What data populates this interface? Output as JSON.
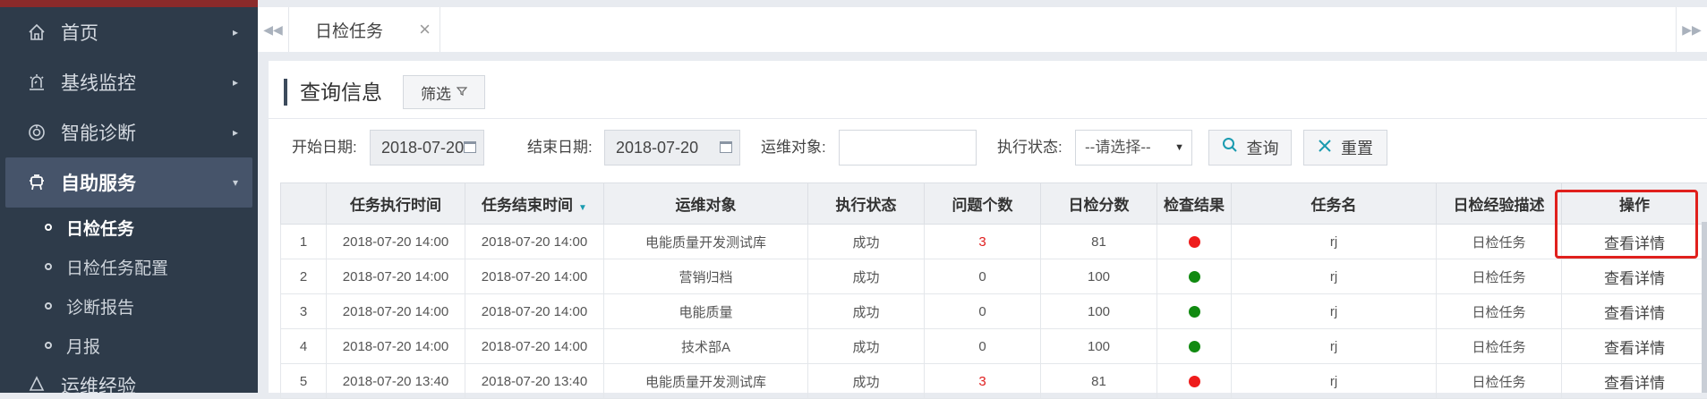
{
  "sidebar": {
    "items": [
      {
        "label": "首页",
        "icon": "home-icon"
      },
      {
        "label": "基线监控",
        "icon": "monitor-alarm-icon"
      },
      {
        "label": "智能诊断",
        "icon": "diagnosis-icon"
      },
      {
        "label": "自助服务",
        "icon": "service-icon",
        "active": true
      }
    ],
    "subitems": [
      {
        "label": "日检任务",
        "active": true
      },
      {
        "label": "日检任务配置"
      },
      {
        "label": "诊断报告"
      },
      {
        "label": "月报"
      }
    ],
    "next_item_partial": "运维经验"
  },
  "tabs": {
    "active_label": "日检任务",
    "close_symbol": "×",
    "prev_symbol": "◀◀",
    "next_symbol": "▶▶"
  },
  "panel": {
    "title": "查询信息",
    "filter_label": "筛选"
  },
  "search": {
    "start_label": "开始日期:",
    "start_value": "2018-07-20",
    "end_label": "结束日期:",
    "end_value": "2018-07-20",
    "target_label": "运维对象:",
    "target_value": "",
    "status_label": "执行状态:",
    "status_selected": "--请选择--",
    "query_label": "查询",
    "reset_label": "重置"
  },
  "table": {
    "headers": [
      "",
      "任务执行时间",
      "任务结束时间",
      "运维对象",
      "执行状态",
      "问题个数",
      "日检分数",
      "检查结果",
      "任务名",
      "日检经验描述",
      "操作"
    ],
    "rows": [
      {
        "idx": "1",
        "start": "2018-07-20 14:00",
        "end": "2018-07-20 14:00",
        "target": "电能质量开发测试库",
        "status": "成功",
        "issues": "3",
        "score": "81",
        "result": "red",
        "task": "rj",
        "desc": "日检任务",
        "action": "查看详情"
      },
      {
        "idx": "2",
        "start": "2018-07-20 14:00",
        "end": "2018-07-20 14:00",
        "target": "营销归档",
        "status": "成功",
        "issues": "0",
        "score": "100",
        "result": "green",
        "task": "rj",
        "desc": "日检任务",
        "action": "查看详情"
      },
      {
        "idx": "3",
        "start": "2018-07-20 14:00",
        "end": "2018-07-20 14:00",
        "target": "电能质量",
        "status": "成功",
        "issues": "0",
        "score": "100",
        "result": "green",
        "task": "rj",
        "desc": "日检任务",
        "action": "查看详情"
      },
      {
        "idx": "4",
        "start": "2018-07-20 14:00",
        "end": "2018-07-20 14:00",
        "target": "技术部A",
        "status": "成功",
        "issues": "0",
        "score": "100",
        "result": "green",
        "task": "rj",
        "desc": "日检任务",
        "action": "查看详情"
      },
      {
        "idx": "5",
        "start": "2018-07-20 13:40",
        "end": "2018-07-20 13:40",
        "target": "电能质量开发测试库",
        "status": "成功",
        "issues": "3",
        "score": "81",
        "result": "red",
        "task": "rj",
        "desc": "日检任务",
        "action": "查看详情"
      }
    ]
  },
  "colors": {
    "sidebar_bg": "#2e3b4a",
    "accent": "#1a9bb0",
    "result_red": "#ee1c1c",
    "result_green": "#118a11",
    "highlight": "#e0201d"
  }
}
